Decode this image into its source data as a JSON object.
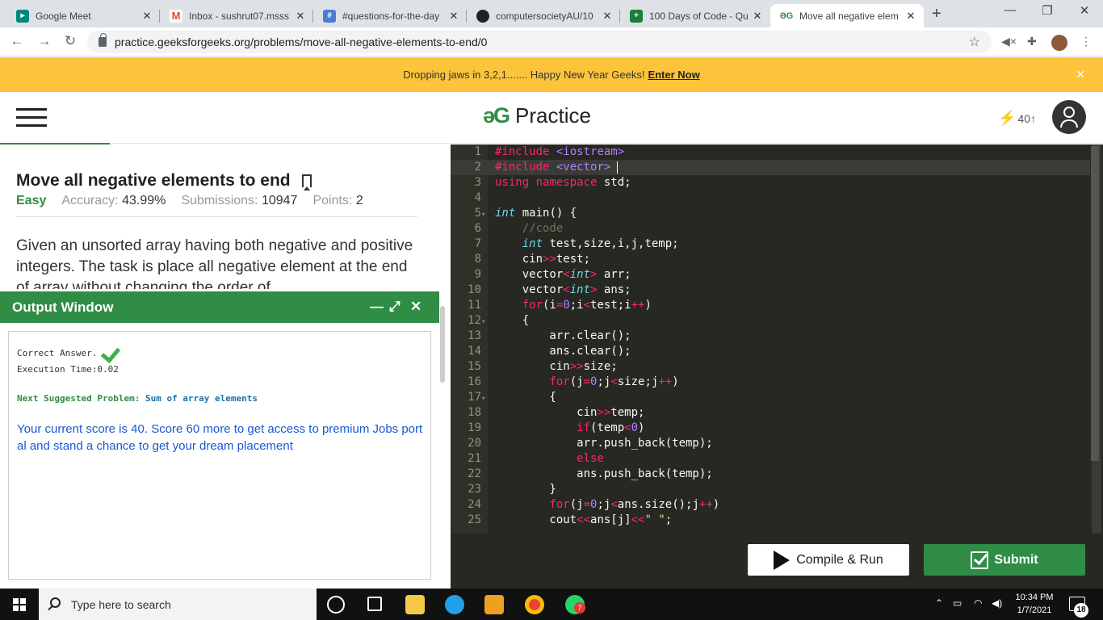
{
  "browser": {
    "tabs": [
      {
        "title": "Google Meet",
        "color": "#00897b"
      },
      {
        "title": "Inbox - sushrut07.msss",
        "color": "#ea4335"
      },
      {
        "title": "#questions-for-the-day",
        "color": "#4a7bd8"
      },
      {
        "title": "computersocietyAU/10",
        "color": "#202124"
      },
      {
        "title": "100 Days of Code - Qu",
        "color": "#188038"
      },
      {
        "title": "Move all negative elem",
        "color": "#2f8d46"
      }
    ],
    "new_tab": "+",
    "url": "practice.geeksforgeeks.org/problems/move-all-negative-elements-to-end/0"
  },
  "banner": {
    "text": "Dropping jaws in 3,2,1....... Happy New Year Geeks!",
    "cta": "Enter Now"
  },
  "header": {
    "logo": "əG",
    "brand": "Practice",
    "streak": "40"
  },
  "problem": {
    "title": "Move all negative elements to end",
    "difficulty": "Easy",
    "accuracy_label": "Accuracy:",
    "accuracy": "43.99%",
    "submissions_label": "Submissions:",
    "submissions": "10947",
    "points_label": "Points:",
    "points": "2",
    "description": "Given an unsorted array having both negative and positive integers. The task is place all negative element at the end of array without changing the order of"
  },
  "output": {
    "title": "Output Window",
    "result": "Correct Answer.",
    "exec_time": "Execution Time:0.02",
    "next_label": "Next Suggested Problem:",
    "next_problem": "Sum of array  elements",
    "score_message": "Your current score is 40. Score 60 more to get access to premium Jobs portal and stand a chance to get your dream placement"
  },
  "editor": {
    "active_line": 2,
    "lines": [
      {
        "n": "1",
        "fold": ""
      },
      {
        "n": "2",
        "fold": ""
      },
      {
        "n": "3",
        "fold": ""
      },
      {
        "n": "4",
        "fold": ""
      },
      {
        "n": "5",
        "fold": "▾"
      },
      {
        "n": "6",
        "fold": ""
      },
      {
        "n": "7",
        "fold": ""
      },
      {
        "n": "8",
        "fold": ""
      },
      {
        "n": "9",
        "fold": ""
      },
      {
        "n": "10",
        "fold": ""
      },
      {
        "n": "11",
        "fold": ""
      },
      {
        "n": "12",
        "fold": "▾"
      },
      {
        "n": "13",
        "fold": ""
      },
      {
        "n": "14",
        "fold": ""
      },
      {
        "n": "15",
        "fold": ""
      },
      {
        "n": "16",
        "fold": ""
      },
      {
        "n": "17",
        "fold": "▾"
      },
      {
        "n": "18",
        "fold": ""
      },
      {
        "n": "19",
        "fold": ""
      },
      {
        "n": "20",
        "fold": ""
      },
      {
        "n": "21",
        "fold": ""
      },
      {
        "n": "22",
        "fold": ""
      },
      {
        "n": "23",
        "fold": ""
      },
      {
        "n": "24",
        "fold": ""
      },
      {
        "n": "25",
        "fold": ""
      }
    ]
  },
  "actions": {
    "compile_run": "Compile & Run",
    "submit": "Submit"
  },
  "taskbar": {
    "search_placeholder": "Type here to search",
    "time": "10:34 PM",
    "date": "1/7/2021",
    "notifications": "18",
    "whatsapp_badge": "7"
  }
}
